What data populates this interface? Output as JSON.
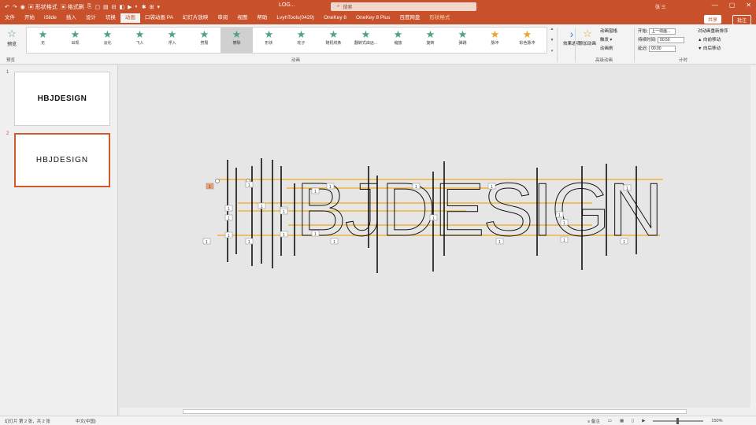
{
  "titlebar": {
    "qat": [
      "↶",
      "↷",
      "◉",
      "▣ 形状格式",
      "▣ 格式刷",
      "⎘",
      "▢",
      "▤",
      "⊟",
      "◧",
      "▶",
      "◐",
      "✱",
      "⊞",
      "▾"
    ],
    "doc_title": "LOG...",
    "search_placeholder": "搜索",
    "user": "张 三",
    "controls": [
      "—",
      "▢",
      "✕"
    ]
  },
  "tabs": [
    "文件",
    "开始",
    "iSlide",
    "插入",
    "设计",
    "切换",
    "动画",
    "口袋动画 PA",
    "幻灯片放映",
    "审阅",
    "视图",
    "帮助",
    "LvyhTools(0429)",
    "OneKey 8",
    "OneKey 8 Plus",
    "百度网盘",
    "形状格式"
  ],
  "active_tab_index": 6,
  "share_label": "共享",
  "comment_label": "批注",
  "ribbon": {
    "preview_label": "预览",
    "gallery": [
      {
        "label": "无",
        "color": "green"
      },
      {
        "label": "出现",
        "color": "green"
      },
      {
        "label": "淡化",
        "color": "green"
      },
      {
        "label": "飞入",
        "color": "green"
      },
      {
        "label": "浮入",
        "color": "green"
      },
      {
        "label": "劈裂",
        "color": "green"
      },
      {
        "label": "擦除",
        "color": "green"
      },
      {
        "label": "形状",
        "color": "green"
      },
      {
        "label": "轮子",
        "color": "green"
      },
      {
        "label": "随机线条",
        "color": "green"
      },
      {
        "label": "翻转式由远...",
        "color": "green"
      },
      {
        "label": "缩放",
        "color": "green"
      },
      {
        "label": "旋转",
        "color": "green"
      },
      {
        "label": "弹跳",
        "color": "green"
      },
      {
        "label": "脉冲",
        "color": "gold"
      },
      {
        "label": "彩色脉冲",
        "color": "gold"
      }
    ],
    "selected_index": 6,
    "effect_options_label": "效果选项",
    "add_animation_label": "添加动画",
    "advanced": [
      "动画窗格",
      "触发 ▾",
      "动画刷"
    ],
    "timing": [
      {
        "label": "开始:",
        "value": "上一动画..."
      },
      {
        "label": "持续时间:",
        "value": "00.50"
      },
      {
        "label": "延迟:",
        "value": "00.00"
      }
    ],
    "reorder_title": "对动画重新排序",
    "reorder": [
      "▲ 向前移动",
      "▼ 向后移动"
    ],
    "group_labels": [
      "预览",
      "动画",
      "高级动画",
      "计时"
    ]
  },
  "slides": [
    {
      "number": "1",
      "text": "HBJDESIGN"
    },
    {
      "number": "2",
      "text": "HBJDESIGN"
    }
  ],
  "canvas": {
    "word": "BJDESIGN",
    "anim_tags": [
      "1",
      "1",
      "1",
      "1",
      "1",
      "1",
      "1",
      "1",
      "1",
      "1",
      "1",
      "1",
      "1",
      "1",
      "1",
      "1",
      "1",
      "1",
      "1",
      "1",
      "1",
      "1",
      "1",
      "1"
    ]
  },
  "statusbar": {
    "left": "幻灯片 第 2 张，共 2 张",
    "middle": "中文(中国)",
    "right": [
      "≡ 备注",
      "▭",
      "▦",
      "▯",
      "▶"
    ],
    "zoom": "150%"
  }
}
